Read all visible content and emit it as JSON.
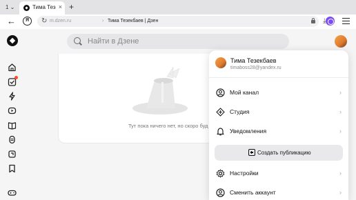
{
  "browser": {
    "tab_count": "1 ⌄",
    "tab_title": "Тима Тезекбаев",
    "tab_close": "×",
    "new_tab": "+",
    "back": "←",
    "yandex_button": "Я",
    "reload": "↻",
    "url_domain": "m.dzen.ru",
    "url_separator": "›",
    "url_title": "Тима Тезекбаев | Дзен",
    "download": "⤓"
  },
  "search": {
    "placeholder": "Найти в Дзене"
  },
  "feed": {
    "empty_text": "Тут пока ничего нет, но скоро буд"
  },
  "account": {
    "name": "Тима Тезекбаев",
    "email": "timaboss28@yandex.ru"
  },
  "menu": {
    "items": [
      {
        "label": "Мой канал",
        "icon": "user-icon"
      },
      {
        "label": "Студия",
        "icon": "studio-icon"
      },
      {
        "label": "Уведомления",
        "icon": "bell-icon"
      }
    ],
    "create_label": "Создать публикацию",
    "settings_label": "Настройки",
    "switch_label": "Сменить аккаунт",
    "chevron": "›"
  },
  "colors": {
    "accent_alice": "#7b4cf5",
    "badge": "#ff4c2e"
  }
}
